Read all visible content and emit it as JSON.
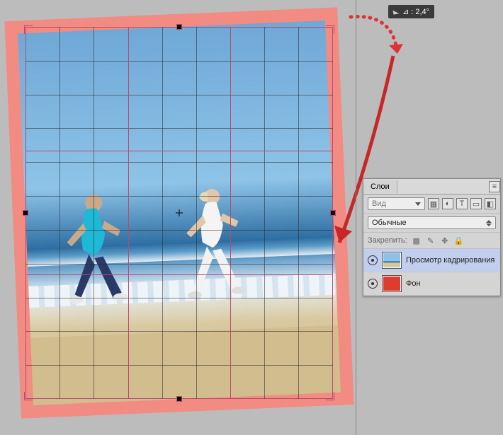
{
  "angle": {
    "label": "⊿ : 2,4°"
  },
  "panel": {
    "title": "Слои",
    "kind_placeholder": "Вид",
    "blend_mode": "Обычные",
    "lock_label": "Закрепить:",
    "layers": [
      {
        "name": "Просмотр кадрирования",
        "active": true,
        "thumb": "beach"
      },
      {
        "name": "Фон",
        "active": false,
        "thumb": "red"
      }
    ]
  }
}
